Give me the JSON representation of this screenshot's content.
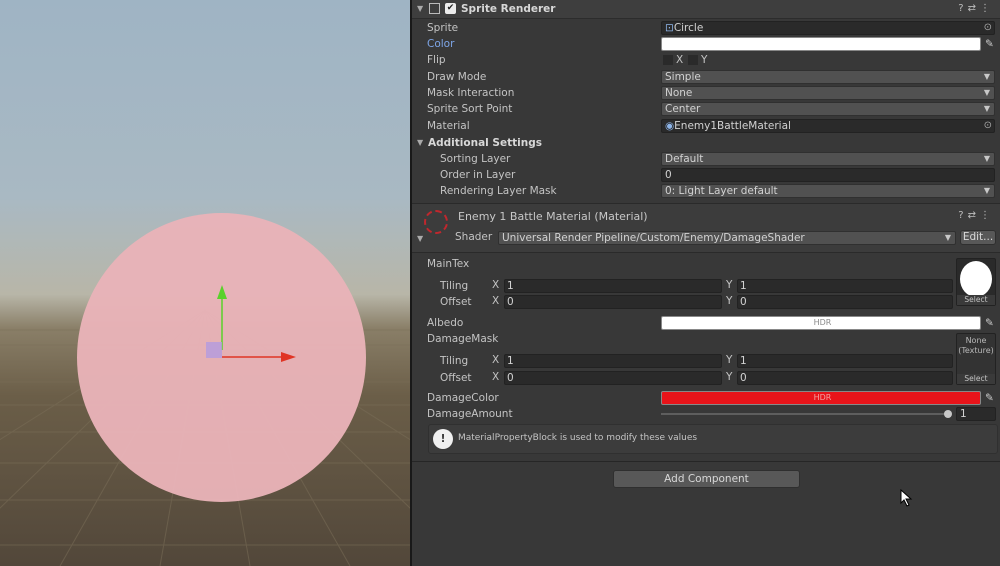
{
  "sprite_renderer": {
    "title": "Sprite Renderer",
    "sprite_label": "Sprite",
    "sprite_value": "Circle",
    "color_label": "Color",
    "color_value": "#ffffff",
    "flip_label": "Flip",
    "flip_x": "X",
    "flip_y": "Y",
    "draw_mode_label": "Draw Mode",
    "draw_mode_value": "Simple",
    "mask_label": "Mask Interaction",
    "mask_value": "None",
    "sort_point_label": "Sprite Sort Point",
    "sort_point_value": "Center",
    "material_label": "Material",
    "material_value": "Enemy1BattleMaterial",
    "additional_settings": "Additional Settings",
    "sorting_layer_label": "Sorting Layer",
    "sorting_layer_value": "Default",
    "order_label": "Order in Layer",
    "order_value": "0",
    "rendering_mask_label": "Rendering Layer Mask",
    "rendering_mask_value": "0: Light Layer default"
  },
  "material": {
    "title": "Enemy 1 Battle Material (Material)",
    "shader_label": "Shader",
    "shader_value": "Universal Render Pipeline/Custom/Enemy/DamageShader",
    "edit_label": "Edit...",
    "maintex_label": "MainTex",
    "tiling_label": "Tiling",
    "offset_label": "Offset",
    "x": "X",
    "y": "Y",
    "maintex_tiling_x": "1",
    "maintex_tiling_y": "1",
    "maintex_offset_x": "0",
    "maintex_offset_y": "0",
    "select_label": "Select",
    "albedo_label": "Albedo",
    "hdr_label": "HDR",
    "damagemask_label": "DamageMask",
    "damagemask_none": "None",
    "damagemask_texture": "(Texture)",
    "mask_tiling_x": "1",
    "mask_tiling_y": "1",
    "mask_offset_x": "0",
    "mask_offset_y": "0",
    "damagecolor_label": "DamageColor",
    "damagecolor_value": "#e8141a",
    "damageamount_label": "DamageAmount",
    "damageamount_value": "1",
    "help_text": "MaterialPropertyBlock is used to modify these values"
  },
  "add_component_label": "Add Component",
  "colors": {
    "sprite_tint": "#e9b3b8",
    "accent_blue": "#7ea6e8",
    "gizmo_y": "#5ad12a",
    "gizmo_x": "#e03424"
  }
}
